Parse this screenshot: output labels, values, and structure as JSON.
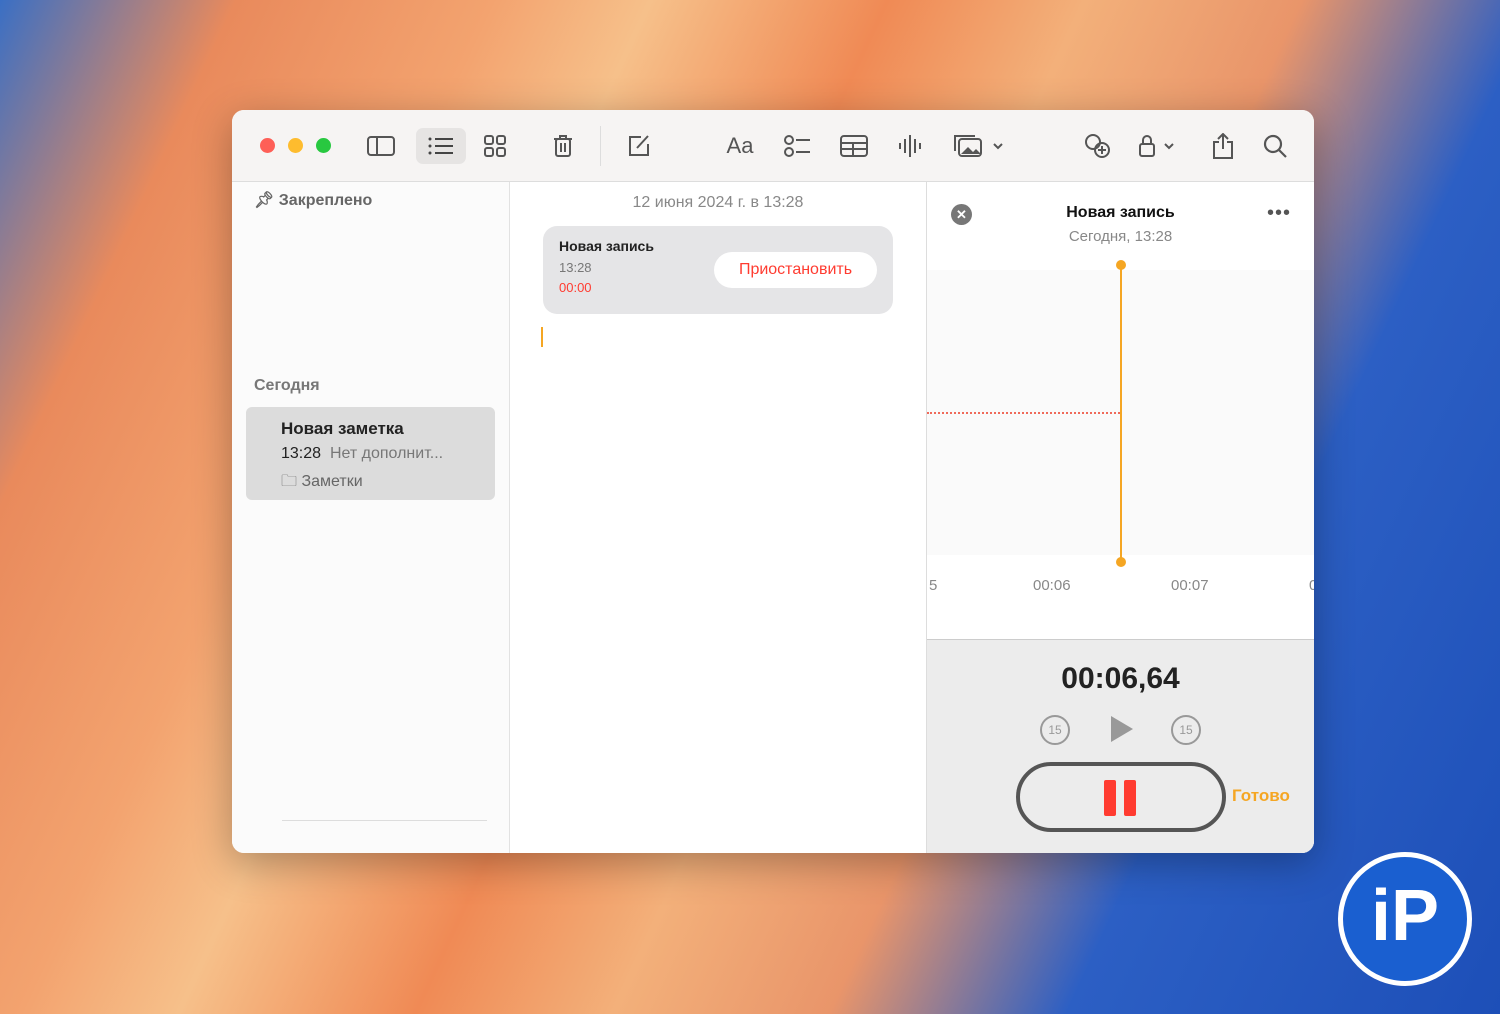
{
  "sidebar": {
    "pinned_label": "Закреплено",
    "today_label": "Сегодня",
    "note": {
      "title": "Новая заметка",
      "time": "13:28",
      "preview": "Нет дополнит...",
      "folder": "Заметки"
    }
  },
  "editor": {
    "date": "12 июня 2024 г. в 13:28",
    "recording_card": {
      "title": "Новая запись",
      "time": "13:28",
      "elapsed": "00:00",
      "pause_label": "Приостановить"
    }
  },
  "recorder": {
    "title": "Новая запись",
    "subtitle": "Сегодня, 13:28",
    "timeline_ticks": [
      "5",
      "00:06",
      "00:07",
      "0"
    ],
    "current_time": "00:06,64",
    "skip_back": "15",
    "skip_forward": "15",
    "done_label": "Готово"
  },
  "colors": {
    "accent": "#f5a623",
    "red": "#ff3b30"
  }
}
